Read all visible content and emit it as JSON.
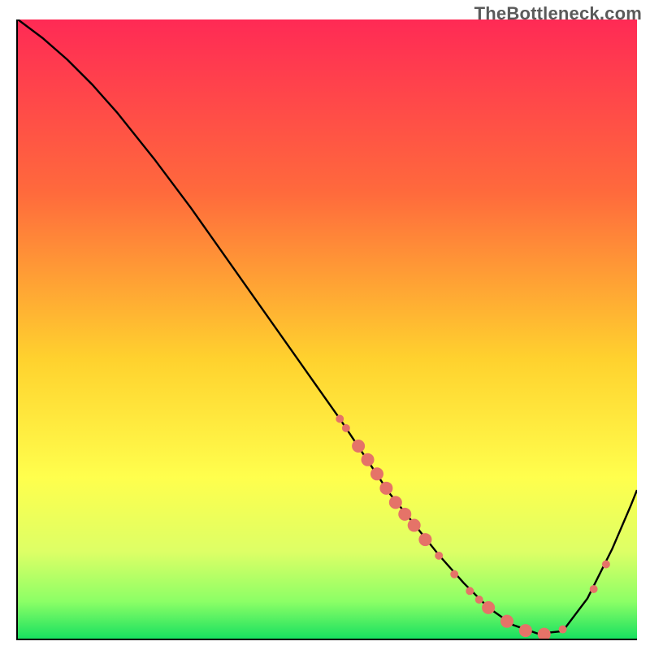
{
  "watermark": "TheBottleneck.com",
  "chart_data": {
    "type": "line",
    "title": "",
    "xlabel": "",
    "ylabel": "",
    "xlim": [
      0,
      100
    ],
    "ylim": [
      0,
      100
    ],
    "grid": false,
    "gradient_stops": [
      {
        "offset": 0,
        "color": "#ff2a55"
      },
      {
        "offset": 28,
        "color": "#ff6a3c"
      },
      {
        "offset": 55,
        "color": "#ffd22e"
      },
      {
        "offset": 74,
        "color": "#ffff4d"
      },
      {
        "offset": 86,
        "color": "#ddff66"
      },
      {
        "offset": 94,
        "color": "#8cff66"
      },
      {
        "offset": 100,
        "color": "#18e060"
      }
    ],
    "series": [
      {
        "name": "bottleneck-curve",
        "color": "#000000",
        "width": 2.4,
        "x": [
          0,
          4,
          8,
          12,
          16,
          22,
          28,
          34,
          40,
          46,
          52,
          56,
          60,
          64,
          68,
          72,
          76,
          80,
          84,
          88,
          92,
          96,
          99,
          100
        ],
        "y": [
          100,
          97,
          93.5,
          89.5,
          85,
          77.5,
          69.5,
          61,
          52.5,
          44,
          35.5,
          29.5,
          23.5,
          18.5,
          13.5,
          9.0,
          5.0,
          2.2,
          0.8,
          1.2,
          6.5,
          14.5,
          21.5,
          24.0
        ]
      }
    ],
    "markers": {
      "name": "highlight-dots",
      "color": "#e57368",
      "radius_small": 5,
      "radius_large": 8,
      "points": [
        {
          "x": 52.0,
          "y": 35.5,
          "r": "small"
        },
        {
          "x": 53.0,
          "y": 34.0,
          "r": "small"
        },
        {
          "x": 55.0,
          "y": 31.1,
          "r": "large"
        },
        {
          "x": 56.5,
          "y": 28.9,
          "r": "large"
        },
        {
          "x": 58.0,
          "y": 26.6,
          "r": "large"
        },
        {
          "x": 59.5,
          "y": 24.3,
          "r": "large"
        },
        {
          "x": 61.0,
          "y": 22.0,
          "r": "large"
        },
        {
          "x": 62.5,
          "y": 20.1,
          "r": "large"
        },
        {
          "x": 64.0,
          "y": 18.3,
          "r": "large"
        },
        {
          "x": 65.8,
          "y": 16.0,
          "r": "large"
        },
        {
          "x": 68.0,
          "y": 13.4,
          "r": "small"
        },
        {
          "x": 70.5,
          "y": 10.4,
          "r": "small"
        },
        {
          "x": 73.0,
          "y": 7.7,
          "r": "small"
        },
        {
          "x": 74.5,
          "y": 6.3,
          "r": "small"
        },
        {
          "x": 76.0,
          "y": 5.0,
          "r": "large"
        },
        {
          "x": 79.0,
          "y": 2.8,
          "r": "large"
        },
        {
          "x": 82.0,
          "y": 1.3,
          "r": "large"
        },
        {
          "x": 85.0,
          "y": 0.7,
          "r": "large"
        },
        {
          "x": 88.0,
          "y": 1.5,
          "r": "small"
        },
        {
          "x": 93.0,
          "y": 8.0,
          "r": "small"
        },
        {
          "x": 95.0,
          "y": 12.0,
          "r": "small"
        }
      ]
    }
  }
}
